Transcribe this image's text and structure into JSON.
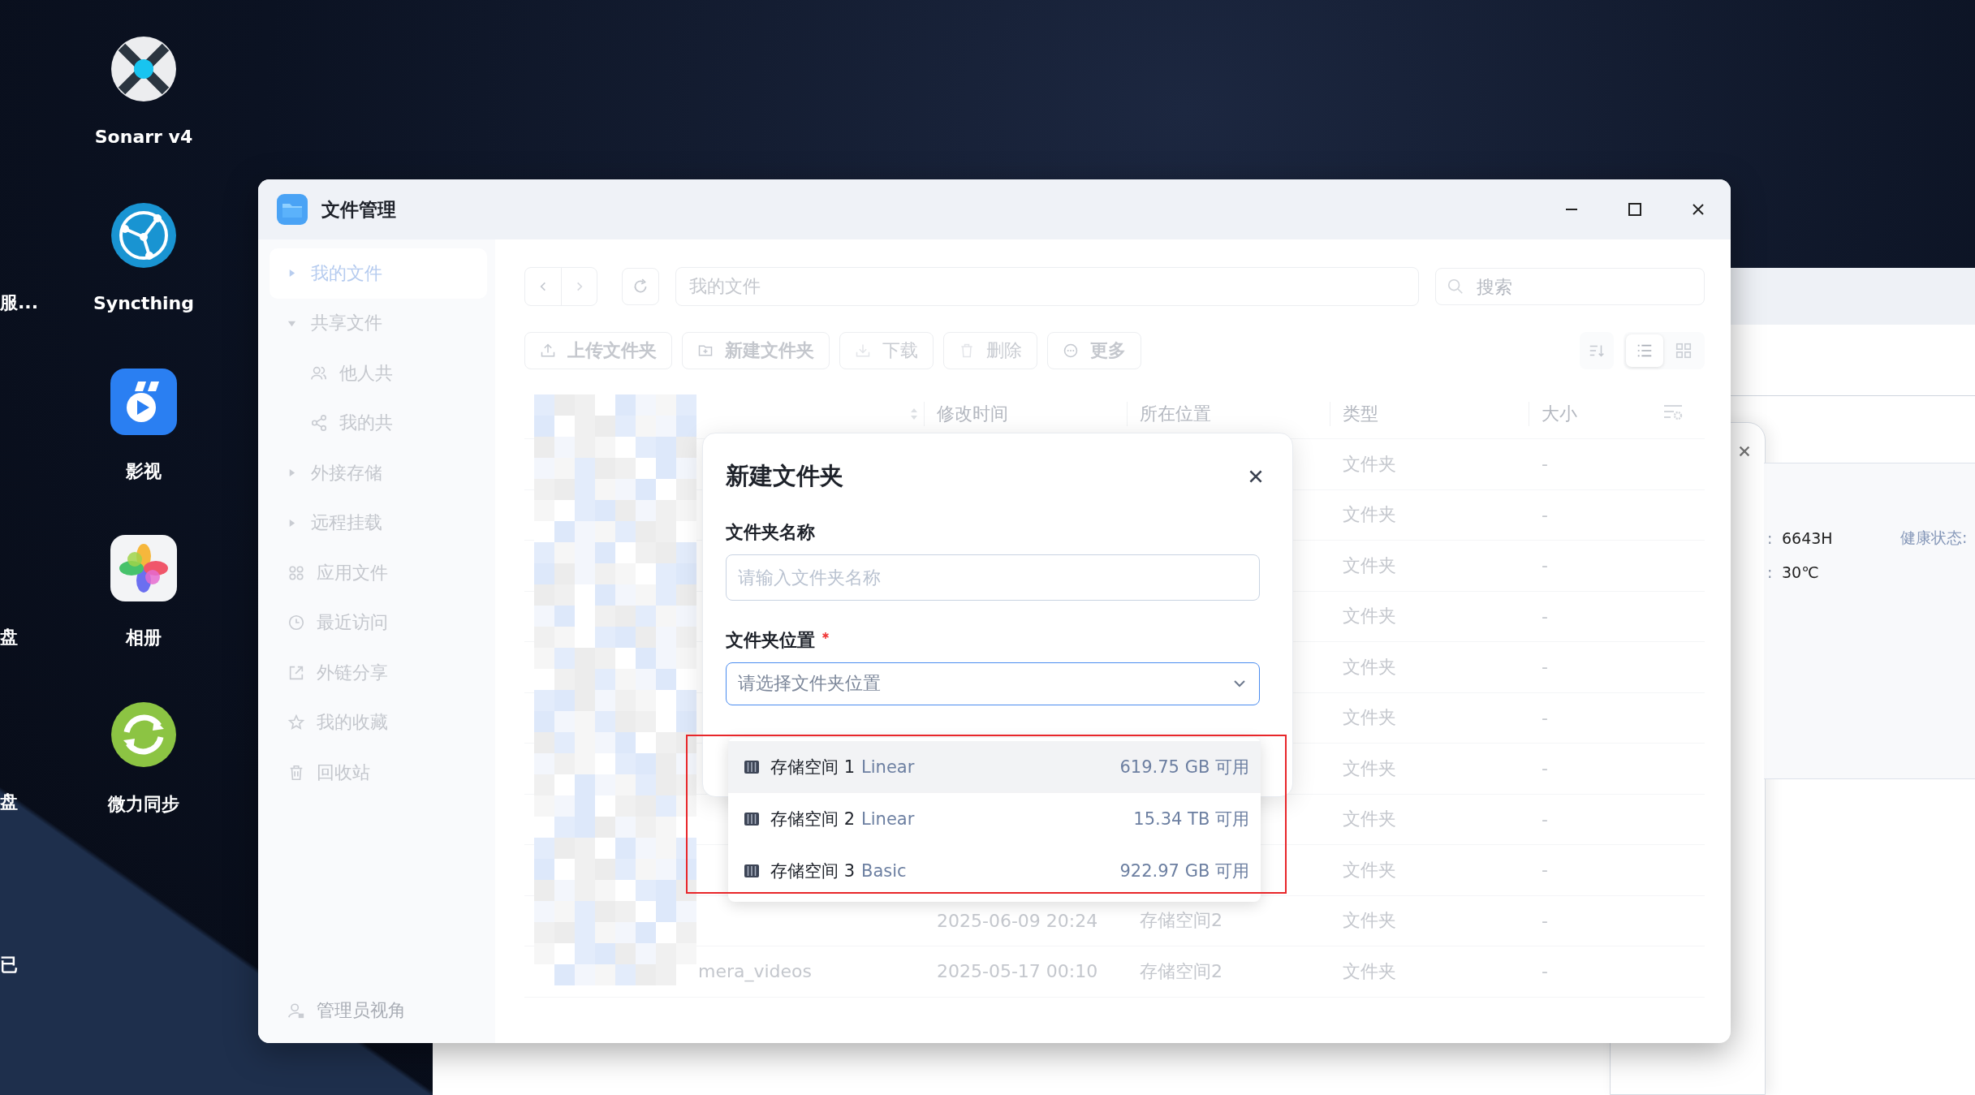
{
  "desktop": {
    "icons": [
      {
        "label": "Sonarr v4",
        "kind": "sonarr"
      },
      {
        "label": "Syncthing",
        "kind": "syncthing"
      },
      {
        "label": "影视",
        "kind": "video"
      },
      {
        "label": "相册",
        "kind": "photos"
      },
      {
        "label": "微力同步",
        "kind": "sync"
      }
    ],
    "edge_labels": [
      "服...",
      "盘",
      "盘",
      "已"
    ]
  },
  "window": {
    "title": "文件管理"
  },
  "sidebar": {
    "items": [
      {
        "label": "我的文件",
        "kind": "group",
        "expanded": false,
        "selected": true
      },
      {
        "label": "共享文件",
        "kind": "group",
        "expanded": true,
        "selected": false,
        "children": [
          {
            "label": "他人共",
            "selected": false
          },
          {
            "label": "我的共",
            "selected": false
          }
        ]
      },
      {
        "label": "外接存储",
        "kind": "group",
        "expanded": false,
        "selected": false
      },
      {
        "label": "远程挂载",
        "kind": "group",
        "expanded": false,
        "selected": false
      },
      {
        "label": "应用文件",
        "kind": "link",
        "selected": false
      },
      {
        "label": "最近访问",
        "kind": "link",
        "selected": false
      },
      {
        "label": "外链分享",
        "kind": "link",
        "selected": false
      },
      {
        "label": "我的收藏",
        "kind": "link",
        "selected": false
      },
      {
        "label": "回收站",
        "kind": "link",
        "selected": false
      }
    ],
    "footer": "管理员视角"
  },
  "toolbar": {
    "path": "我的文件",
    "search_placeholder": "搜索",
    "actions": [
      {
        "label": "上传文件夹",
        "disabled": false
      },
      {
        "label": "新建文件夹",
        "disabled": false
      },
      {
        "label": "下载",
        "disabled": true
      },
      {
        "label": "删除",
        "disabled": true
      },
      {
        "label": "更多",
        "disabled": false
      }
    ],
    "views": [
      {
        "selected": true
      },
      {
        "selected": false
      }
    ]
  },
  "table": {
    "columns": [
      "修改时间",
      "所在位置",
      "类型",
      "大小"
    ],
    "rows": [
      {
        "type": "文件夹",
        "size": "-"
      },
      {
        "type": "文件夹",
        "size": "-"
      },
      {
        "type": "文件夹",
        "size": "-"
      },
      {
        "type": "文件夹",
        "size": "-"
      },
      {
        "type": "文件夹",
        "size": "-"
      },
      {
        "type": "文件夹",
        "size": "-"
      },
      {
        "type": "文件夹",
        "size": "-"
      },
      {
        "type": "文件夹",
        "size": "-"
      },
      {
        "type": "文件夹",
        "size": "-"
      },
      {
        "modified": "2025-06-09 20:24",
        "location": "存储空间2",
        "type": "文件夹",
        "size": "-"
      },
      {
        "name": "mera_videos",
        "modified": "2025-05-17 00:10",
        "location": "存储空间2",
        "type": "文件夹",
        "size": "-"
      }
    ]
  },
  "dialog": {
    "title": "新建文件夹",
    "name_label": "文件夹名称",
    "name_placeholder": "请输入文件夹名称",
    "location_label": "文件夹位置",
    "location_required": true,
    "location_placeholder": "请选择文件夹位置",
    "options": [
      {
        "name": "存储空间 1",
        "type": "Linear",
        "free": "619.75 GB 可用",
        "highlighted": true
      },
      {
        "name": "存储空间 2",
        "type": "Linear",
        "free": "15.34 TB 可用",
        "highlighted": false
      },
      {
        "name": "存储空间 3",
        "type": "Basic",
        "free": "922.97 GB 可用",
        "highlighted": false
      }
    ]
  },
  "background_window": {
    "rows": [
      {
        "label": ":",
        "value": "6643H"
      },
      {
        "label": ":",
        "value": "30℃"
      }
    ],
    "health_label": "健康状态:"
  }
}
